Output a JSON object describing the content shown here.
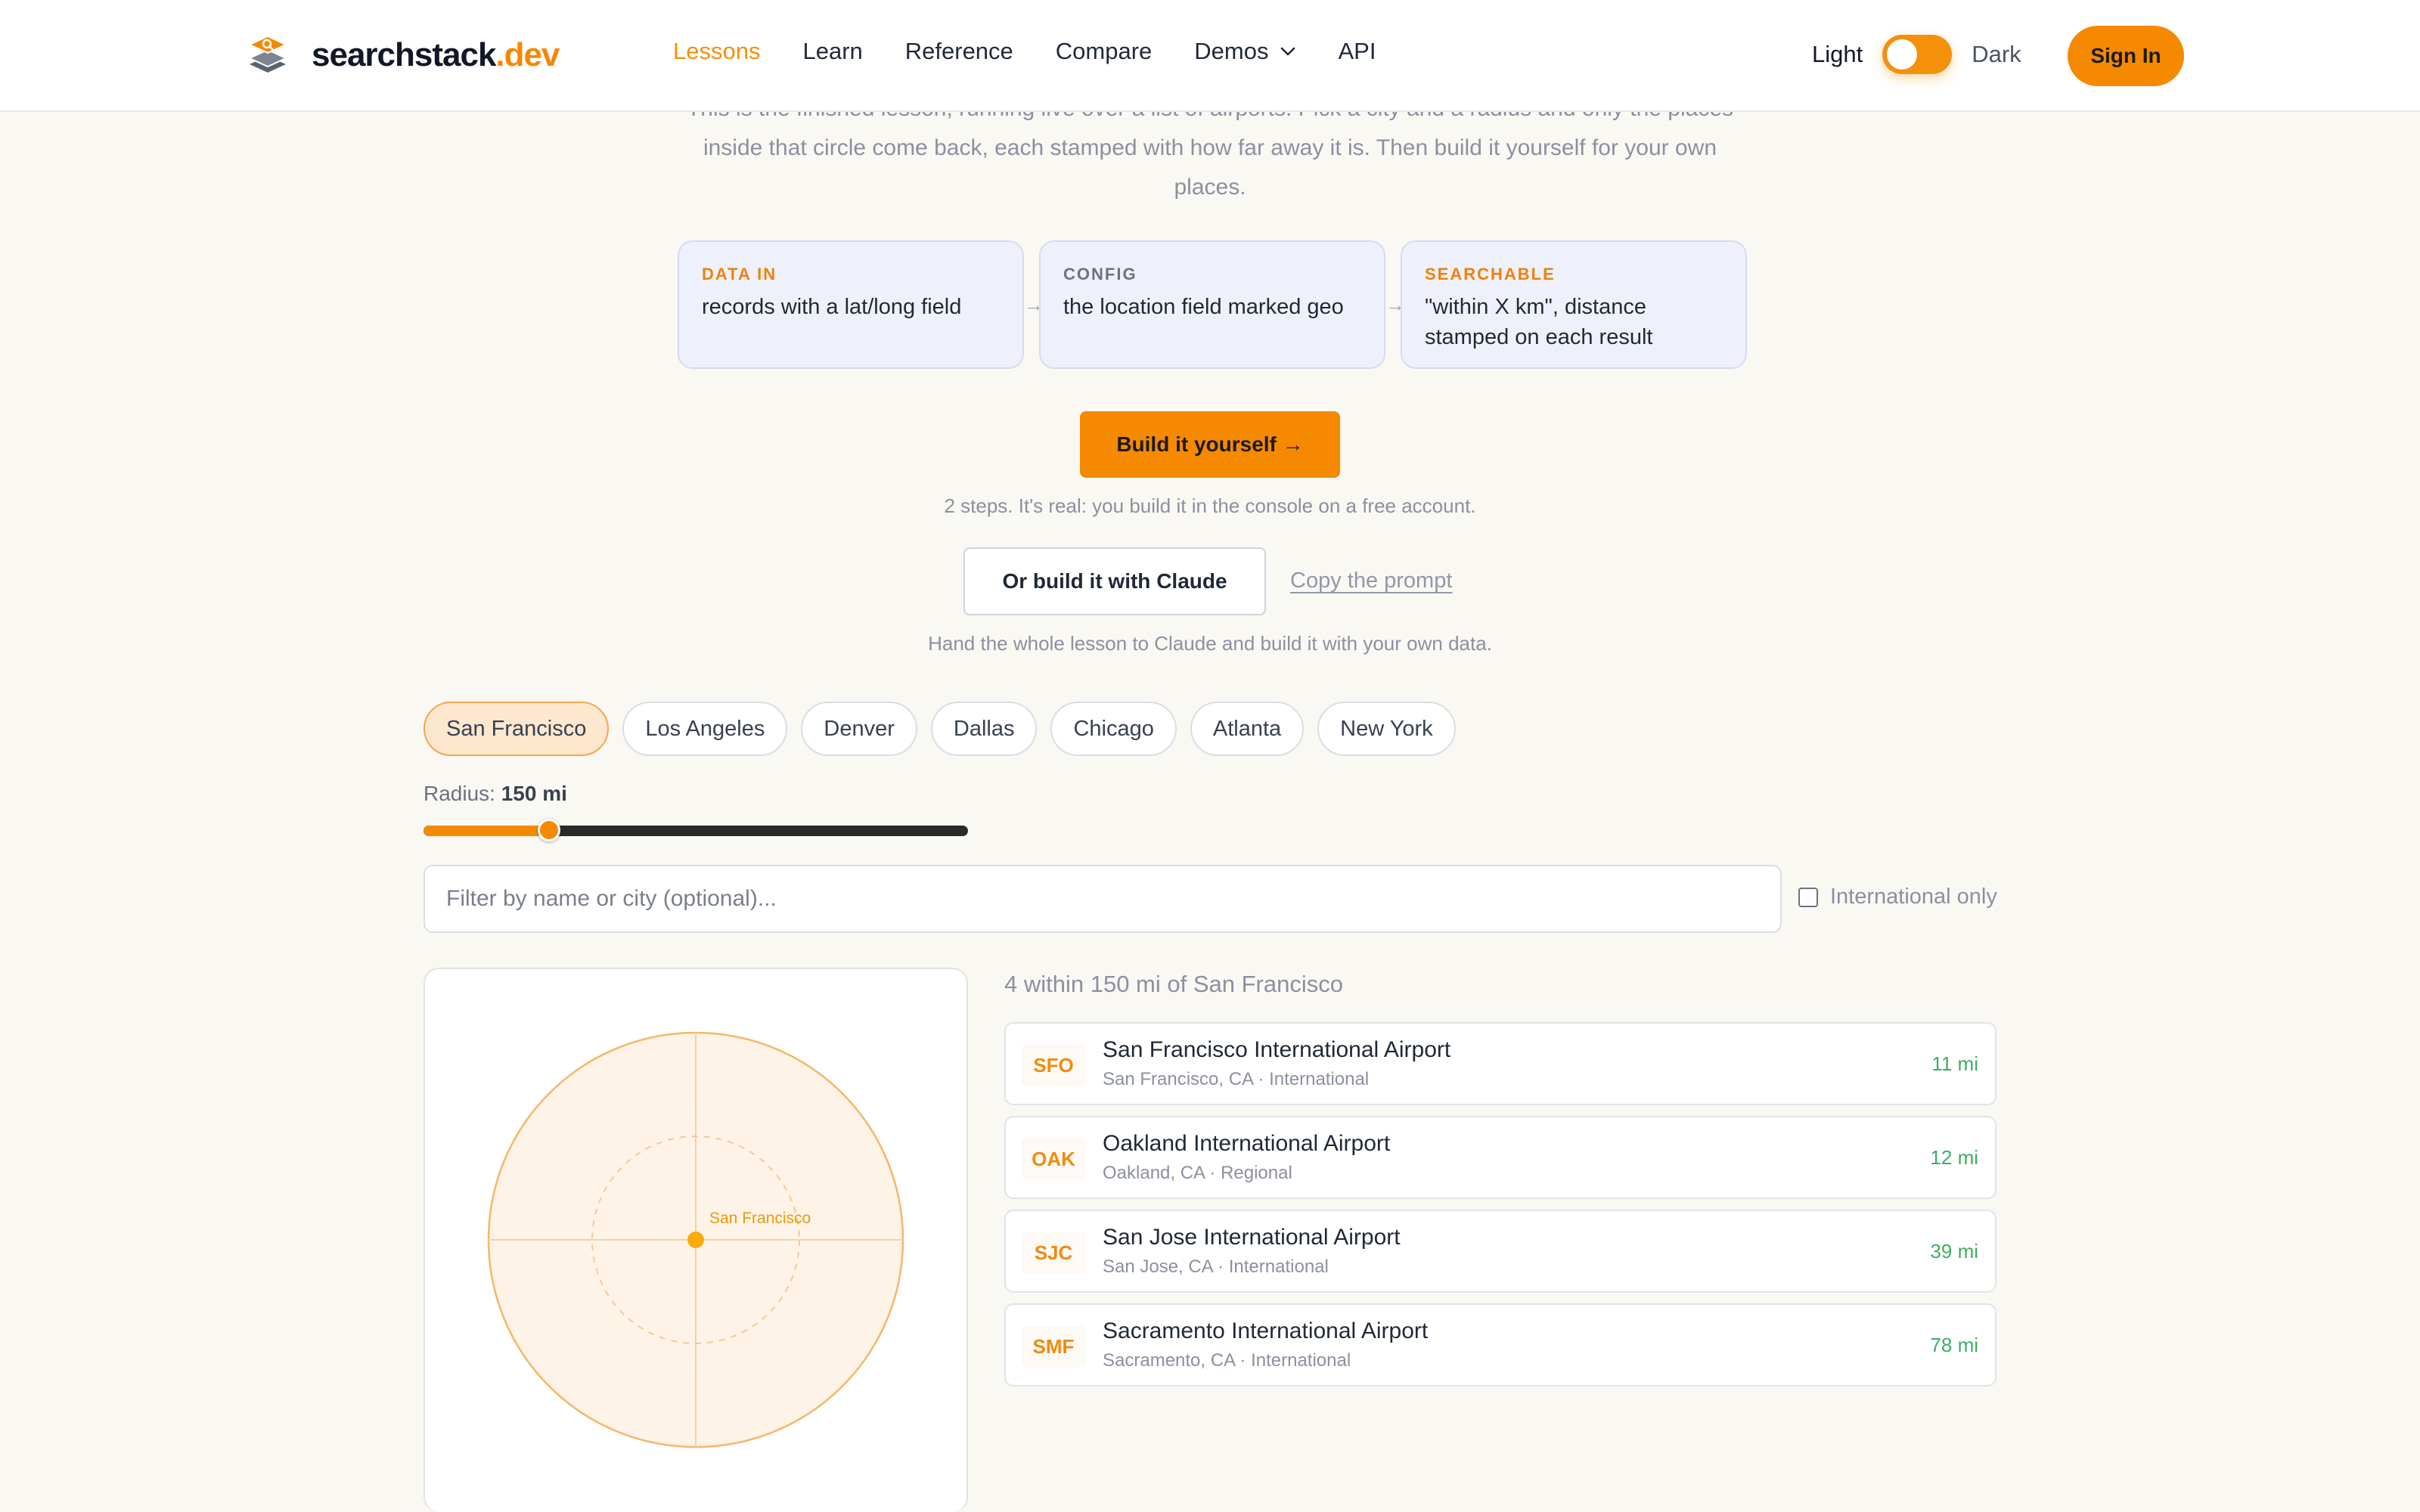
{
  "header": {
    "logo_main": "searchstack",
    "logo_accent": ".dev",
    "nav": [
      {
        "label": "Lessons",
        "active": true
      },
      {
        "label": "Learn"
      },
      {
        "label": "Reference"
      },
      {
        "label": "Compare"
      },
      {
        "label": "Demos",
        "dropdown": true
      },
      {
        "label": "API"
      }
    ],
    "theme_light": "Light",
    "theme_dark": "Dark",
    "theme_toggle_state": "light",
    "signin_label": "Sign In"
  },
  "intro": {
    "text": "This is the finished lesson, running live over a list of airports. Pick a city and a radius and only the places inside that circle come back, each stamped with how far away it is. Then build it yourself for your own places."
  },
  "flow": [
    {
      "tag": "DATA IN",
      "text": "records with a lat/long field",
      "tag_color": "#f0800a"
    },
    {
      "tag": "CONFIG",
      "text": "the location field marked geo",
      "tag_color": "#6b7280"
    },
    {
      "tag": "SEARCHABLE",
      "text": "\"within X km\", distance stamped on each result",
      "tag_color": "#f0800a"
    }
  ],
  "flow_arrow": "→",
  "cta": {
    "build_label": "Build it yourself →",
    "build_note": "2 steps. It's real: you build it in the console on a free account.",
    "claude_label": "Or build it with Claude",
    "copy_prompt_label": "Copy the prompt",
    "claude_note": "Hand the whole lesson to Claude and build it with your own data."
  },
  "cities": [
    "San Francisco",
    "Los Angeles",
    "Denver",
    "Dallas",
    "Chicago",
    "Atlanta",
    "New York"
  ],
  "selected_city": "San Francisco",
  "radius": {
    "label": "Radius:",
    "value_label": "150 mi",
    "fraction": 0.23
  },
  "filter": {
    "placeholder": "Filter by name or city (optional)...",
    "value": ""
  },
  "international_only": {
    "label": "International only",
    "checked": false
  },
  "map": {
    "center_label": "San Francisco"
  },
  "results": {
    "count_text": "4 within 150 mi of San Francisco",
    "items": [
      {
        "code": "SFO",
        "name": "San Francisco International Airport",
        "meta": "San Francisco, CA · International",
        "distance": "11 mi"
      },
      {
        "code": "OAK",
        "name": "Oakland International Airport",
        "meta": "Oakland, CA · Regional",
        "distance": "12 mi"
      },
      {
        "code": "SJC",
        "name": "San Jose International Airport",
        "meta": "San Jose, CA · International",
        "distance": "39 mi"
      },
      {
        "code": "SMF",
        "name": "Sacramento International Airport",
        "meta": "Sacramento, CA · International",
        "distance": "78 mi"
      }
    ]
  },
  "colors": {
    "accent": "#f58a00",
    "distance": "#3cae63",
    "code": "#f28a0d"
  }
}
